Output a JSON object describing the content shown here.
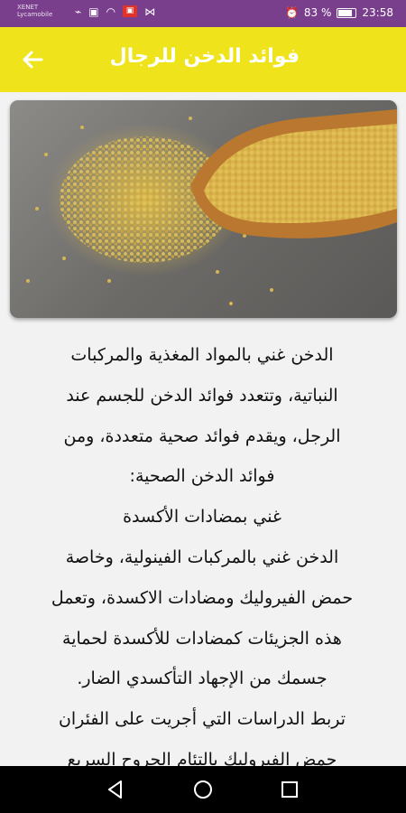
{
  "status_bar": {
    "carrier_line1": "XENET",
    "carrier_line2": "Lycamobile",
    "battery": "83 %",
    "time": "23:58"
  },
  "app_bar": {
    "title": "فوائد الدخن للرجال",
    "back_icon": "arrow-back-icon",
    "background": "#efe41b"
  },
  "article": {
    "lines": [
      "الدخن غني بالمواد المغذية والمركبات",
      "النباتية، وتتعدد فوائد الدخن للجسم عند",
      "الرجل، ويقدم فوائد صحية متعددة، ومن",
      "فوائد الدخن الصحية:",
      "غني بمضادات الأكسدة",
      "الدخن غني بالمركبات الفينولية، وخاصة",
      "حمض الفيروليك ومضادات الاكسدة، وتعمل",
      "هذه الجزيئات كمضادات للأكسدة لحماية",
      "جسمك من الإجهاد التأكسدي الضار.",
      "تربط الدراسات التي أجريت على الفئران",
      "حمض الفيروليك بالتئام الجروح السريع"
    ]
  },
  "nav": {
    "back_icon": "nav-back-icon",
    "home_icon": "nav-home-icon",
    "recents_icon": "nav-recents-icon"
  },
  "colors": {
    "status_bar": "#7a3f8c",
    "app_bar": "#efe41b",
    "nav_bar": "#000000"
  }
}
